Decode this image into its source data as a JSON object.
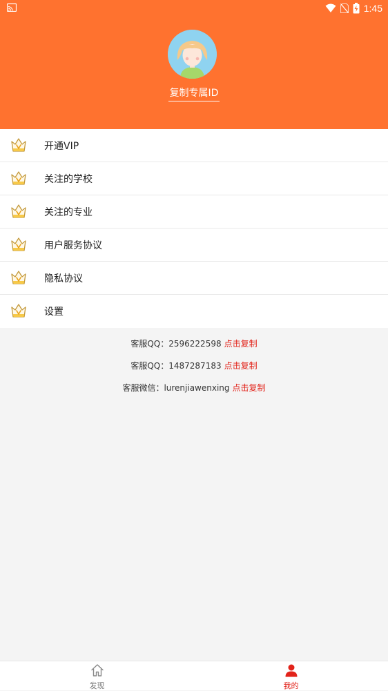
{
  "status_bar": {
    "time": "1:45"
  },
  "profile": {
    "copy_id_label": "复制专属ID"
  },
  "menu": {
    "items": [
      {
        "label": "开通VIP"
      },
      {
        "label": "关注的学校"
      },
      {
        "label": "关注的专业"
      },
      {
        "label": "用户服务协议"
      },
      {
        "label": "隐私协议"
      },
      {
        "label": "设置"
      }
    ]
  },
  "contacts": [
    {
      "text": "客服QQ：2596222598",
      "action": "点击复制"
    },
    {
      "text": "客服QQ：1487287183",
      "action": "点击复制"
    },
    {
      "text": "客服微信：lurenjiawenxing",
      "action": "点击复制"
    }
  ],
  "tabbar": {
    "tabs": [
      {
        "label": "发现",
        "icon": "home-icon",
        "active": false
      },
      {
        "label": "我的",
        "icon": "user-icon",
        "active": true
      }
    ]
  },
  "colors": {
    "brand": "#ff722f",
    "accent": "#e2231a"
  }
}
